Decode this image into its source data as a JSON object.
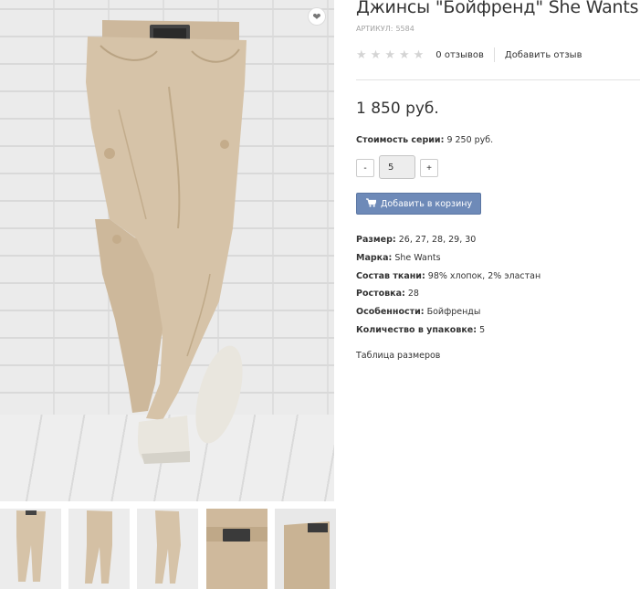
{
  "product": {
    "title": "Джинсы \"Бойфренд\" She Wants",
    "sku_label": "АРТИКУЛ:",
    "sku_value": "5584",
    "rating_stars": 0,
    "reviews_link": "0 отзывов",
    "add_review": "Добавить отзыв",
    "price": "1 850 руб.",
    "series_label": "Стоимость серии:",
    "series_value": "9 250 руб.",
    "quantity": {
      "minus": "-",
      "value": "5",
      "plus": "+"
    },
    "add_to_cart": "Добавить в корзину",
    "properties": [
      {
        "label": "Размер:",
        "value": "26, 27, 28, 29, 30"
      },
      {
        "label": "Марка:",
        "value": "She Wants"
      },
      {
        "label": "Состав ткани:",
        "value": "98% хлопок, 2% эластан"
      },
      {
        "label": "Ростовка:",
        "value": "28"
      },
      {
        "label": "Особенности:",
        "value": "Бойфренды"
      },
      {
        "label": "Количество в упаковке:",
        "value": "5"
      }
    ],
    "size_table_link": "Таблица размеров"
  },
  "icons": {
    "favorite": "heart-icon",
    "cart": "cart-icon",
    "star": "star-icon"
  },
  "colors": {
    "cart_button": "#6e8ab8",
    "jeans": "#d6c3a8",
    "star_empty": "#d4d4d4"
  },
  "thumbnails": [
    {
      "id": "thumb-1"
    },
    {
      "id": "thumb-2"
    },
    {
      "id": "thumb-3"
    },
    {
      "id": "thumb-4"
    },
    {
      "id": "thumb-5"
    }
  ]
}
